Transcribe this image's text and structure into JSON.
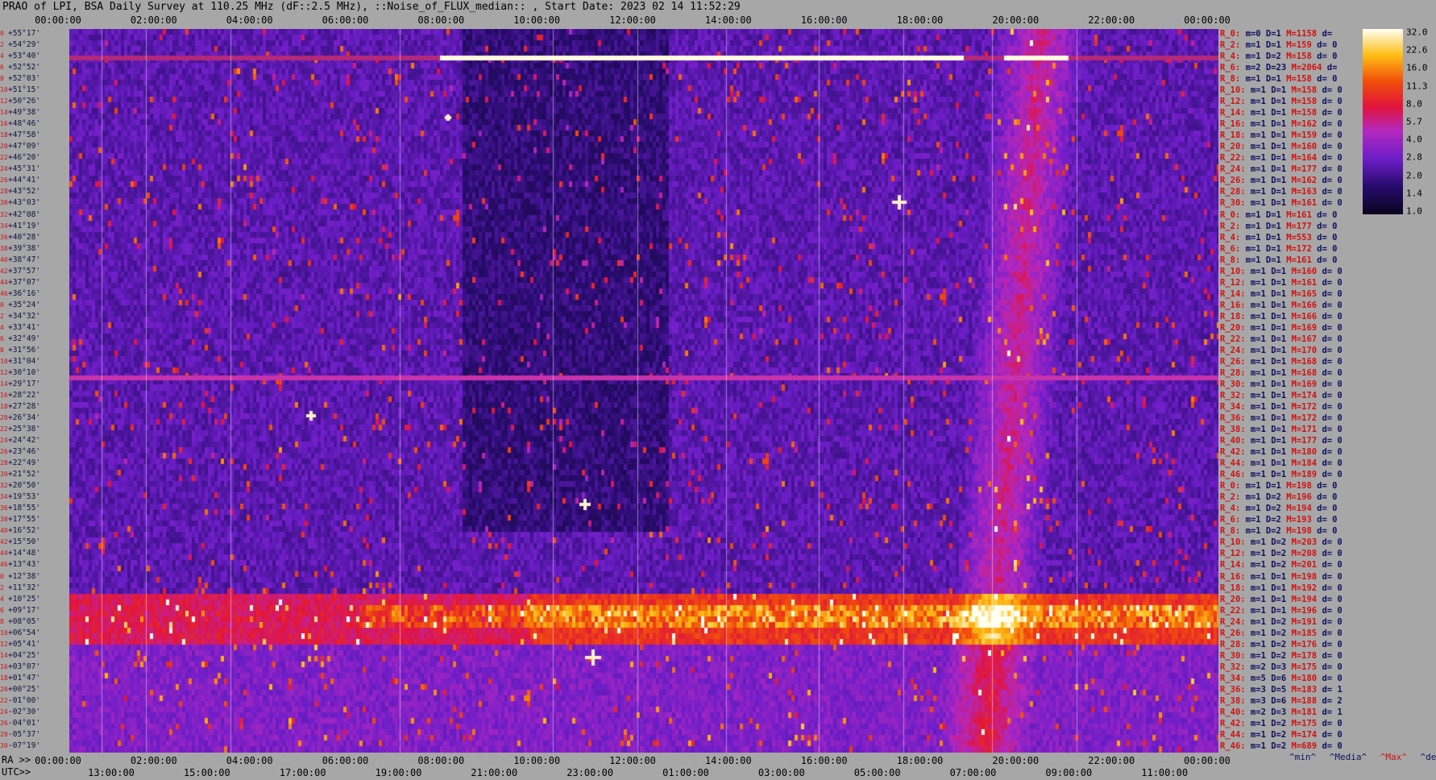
{
  "title": "PRAO of LPI, BSA Daily Survey at 110.25 MHz (dF::2.5 MHz), ::Noise_of_FLUX_median:: , Start Date: 2023 02 14 11:52:29",
  "top_axis": [
    "00:00:00",
    "02:00:00",
    "04:00:00",
    "06:00:00",
    "08:00:00",
    "10:00:00",
    "12:00:00",
    "14:00:00",
    "16:00:00",
    "18:00:00",
    "20:00:00",
    "22:00:00",
    "00:00:00"
  ],
  "ra_label": "RA >>",
  "ra_axis": [
    "00:00:00",
    "02:00:00",
    "04:00:00",
    "06:00:00",
    "08:00:00",
    "10:00:00",
    "12:00:00",
    "14:00:00",
    "16:00:00",
    "18:00:00",
    "20:00:00",
    "22:00:00",
    "00:00:00"
  ],
  "utc_label": "UTC>>",
  "utc_axis": [
    "13:00:00",
    "15:00:00",
    "17:00:00",
    "19:00:00",
    "21:00:00",
    "23:00:00",
    "01:00:00",
    "03:00:00",
    "05:00:00",
    "07:00:00",
    "09:00:00",
    "11:00:00"
  ],
  "footer": {
    "min": "^min^",
    "media": "^Media^",
    "max": "^Max^",
    "devia": "^devia^"
  },
  "colors": {
    "background": "#a7a7a7",
    "accent_red": "#d41010",
    "label_blue": "#101040"
  },
  "chart_data": {
    "type": "heatmap",
    "title": "PRAO of LPI, BSA Daily Survey at 110.25 MHz (dF::2.5 MHz), ::Noise_of_FLUX_median:: , Start Date: 2023 02 14 11:52:29",
    "x_axis_top": "RA 00:00:00 – 24:00:00",
    "y_axis": "Declination (beam rows)",
    "colorbar_ticks": [
      "32.0",
      "22.6",
      "16.0",
      "11.3",
      "8.0",
      "5.7",
      "4.0",
      "2.8",
      "2.0",
      "1.4",
      "1.0"
    ],
    "colorbar_scale": "log",
    "declinations": [
      {
        "idx": "0",
        "dec": "+55°17'"
      },
      {
        "idx": "2",
        "dec": "+54°29'"
      },
      {
        "idx": "4",
        "dec": "+53°40'"
      },
      {
        "idx": "6",
        "dec": "+52°52'"
      },
      {
        "idx": "8",
        "dec": "+52°03'"
      },
      {
        "idx": "10",
        "dec": "+51°15'"
      },
      {
        "idx": "12",
        "dec": "+50°26'"
      },
      {
        "idx": "14",
        "dec": "+49°38'"
      },
      {
        "idx": "16",
        "dec": "+48°46'"
      },
      {
        "idx": "18",
        "dec": "+47°58'"
      },
      {
        "idx": "20",
        "dec": "+47°09'"
      },
      {
        "idx": "22",
        "dec": "+46°20'"
      },
      {
        "idx": "24",
        "dec": "+45°31'"
      },
      {
        "idx": "26",
        "dec": "+44°41'"
      },
      {
        "idx": "28",
        "dec": "+43°52'"
      },
      {
        "idx": "30",
        "dec": "+43°03'"
      },
      {
        "idx": "32",
        "dec": "+42°08'"
      },
      {
        "idx": "34",
        "dec": "+41°19'"
      },
      {
        "idx": "36",
        "dec": "+40°28'"
      },
      {
        "idx": "38",
        "dec": "+39°38'"
      },
      {
        "idx": "40",
        "dec": "+38°47'"
      },
      {
        "idx": "42",
        "dec": "+37°57'"
      },
      {
        "idx": "44",
        "dec": "+37°07'"
      },
      {
        "idx": "46",
        "dec": "+36°16'"
      },
      {
        "idx": "0",
        "dec": "+35°24'"
      },
      {
        "idx": "2",
        "dec": "+34°32'"
      },
      {
        "idx": "4",
        "dec": "+33°41'"
      },
      {
        "idx": "6",
        "dec": "+32°49'"
      },
      {
        "idx": "8",
        "dec": "+31°56'"
      },
      {
        "idx": "10",
        "dec": "+31°04'"
      },
      {
        "idx": "12",
        "dec": "+30°10'"
      },
      {
        "idx": "14",
        "dec": "+29°17'"
      },
      {
        "idx": "16",
        "dec": "+28°22'"
      },
      {
        "idx": "18",
        "dec": "+27°28'"
      },
      {
        "idx": "20",
        "dec": "+26°34'"
      },
      {
        "idx": "22",
        "dec": "+25°38'"
      },
      {
        "idx": "24",
        "dec": "+24°42'"
      },
      {
        "idx": "26",
        "dec": "+23°46'"
      },
      {
        "idx": "28",
        "dec": "+22°49'"
      },
      {
        "idx": "30",
        "dec": "+21°52'"
      },
      {
        "idx": "32",
        "dec": "+20°50'"
      },
      {
        "idx": "34",
        "dec": "+19°53'"
      },
      {
        "idx": "36",
        "dec": "+18°55'"
      },
      {
        "idx": "38",
        "dec": "+17°55'"
      },
      {
        "idx": "40",
        "dec": "+16°52'"
      },
      {
        "idx": "42",
        "dec": "+15°50'"
      },
      {
        "idx": "44",
        "dec": "+14°48'"
      },
      {
        "idx": "46",
        "dec": "+13°43'"
      },
      {
        "idx": "0",
        "dec": "+12°38'"
      },
      {
        "idx": "2",
        "dec": "+11°32'"
      },
      {
        "idx": "4",
        "dec": "+10°25'"
      },
      {
        "idx": "6",
        "dec": "+09°17'"
      },
      {
        "idx": "8",
        "dec": "+08°05'"
      },
      {
        "idx": "10",
        "dec": "+06°54'"
      },
      {
        "idx": "12",
        "dec": "+05°41'"
      },
      {
        "idx": "14",
        "dec": "+04°25'"
      },
      {
        "idx": "16",
        "dec": "+03°07'"
      },
      {
        "idx": "18",
        "dec": "+01°47'"
      },
      {
        "idx": "20",
        "dec": "+00°25'"
      },
      {
        "idx": "22",
        "dec": "-01°00'"
      },
      {
        "idx": "24",
        "dec": "-02°30'"
      },
      {
        "idx": "26",
        "dec": "-04°01'"
      },
      {
        "idx": "28",
        "dec": "-05°37'"
      },
      {
        "idx": "30",
        "dec": "-07°19'"
      }
    ],
    "stats": [
      {
        "r": "R_0:",
        "m": "m=0",
        "d": "D=1",
        "mx": "M=1158",
        "dv": "d="
      },
      {
        "r": "R_2:",
        "m": "m=1",
        "d": "D=1",
        "mx": "M=159",
        "dv": "d= 0"
      },
      {
        "r": "R_4:",
        "m": "m=1",
        "d": "D=2",
        "mx": "M=158",
        "dv": "d= 0"
      },
      {
        "r": "R_6:",
        "m": "m=2",
        "d": "D=23",
        "mx": "M=2064",
        "dv": "d="
      },
      {
        "r": "R_8:",
        "m": "m=1",
        "d": "D=1",
        "mx": "M=158",
        "dv": "d= 0"
      },
      {
        "r": "R_10:",
        "m": "m=1",
        "d": "D=1",
        "mx": "M=158",
        "dv": "d= 0"
      },
      {
        "r": "R_12:",
        "m": "m=1",
        "d": "D=1",
        "mx": "M=158",
        "dv": "d= 0"
      },
      {
        "r": "R_14:",
        "m": "m=1",
        "d": "D=1",
        "mx": "M=158",
        "dv": "d= 0"
      },
      {
        "r": "R_16:",
        "m": "m=1",
        "d": "D=1",
        "mx": "M=162",
        "dv": "d= 0"
      },
      {
        "r": "R_18:",
        "m": "m=1",
        "d": "D=1",
        "mx": "M=159",
        "dv": "d= 0"
      },
      {
        "r": "R_20:",
        "m": "m=1",
        "d": "D=1",
        "mx": "M=160",
        "dv": "d= 0"
      },
      {
        "r": "R_22:",
        "m": "m=1",
        "d": "D=1",
        "mx": "M=164",
        "dv": "d= 0"
      },
      {
        "r": "R_24:",
        "m": "m=1",
        "d": "D=1",
        "mx": "M=177",
        "dv": "d= 0"
      },
      {
        "r": "R_26:",
        "m": "m=1",
        "d": "D=1",
        "mx": "M=162",
        "dv": "d= 0"
      },
      {
        "r": "R_28:",
        "m": "m=1",
        "d": "D=1",
        "mx": "M=163",
        "dv": "d= 0"
      },
      {
        "r": "R_30:",
        "m": "m=1",
        "d": "D=1",
        "mx": "M=161",
        "dv": "d= 0"
      },
      {
        "r": "R_0:",
        "m": "m=1",
        "d": "D=1",
        "mx": "M=161",
        "dv": "d= 0"
      },
      {
        "r": "R_2:",
        "m": "m=1",
        "d": "D=1",
        "mx": "M=177",
        "dv": "d= 0"
      },
      {
        "r": "R_4:",
        "m": "m=1",
        "d": "D=1",
        "mx": "M=553",
        "dv": "d= 0"
      },
      {
        "r": "R_6:",
        "m": "m=1",
        "d": "D=1",
        "mx": "M=172",
        "dv": "d= 0"
      },
      {
        "r": "R_8:",
        "m": "m=1",
        "d": "D=1",
        "mx": "M=161",
        "dv": "d= 0"
      },
      {
        "r": "R_10:",
        "m": "m=1",
        "d": "D=1",
        "mx": "M=160",
        "dv": "d= 0"
      },
      {
        "r": "R_12:",
        "m": "m=1",
        "d": "D=1",
        "mx": "M=161",
        "dv": "d= 0"
      },
      {
        "r": "R_14:",
        "m": "m=1",
        "d": "D=1",
        "mx": "M=165",
        "dv": "d= 0"
      },
      {
        "r": "R_16:",
        "m": "m=1",
        "d": "D=1",
        "mx": "M=166",
        "dv": "d= 0"
      },
      {
        "r": "R_18:",
        "m": "m=1",
        "d": "D=1",
        "mx": "M=166",
        "dv": "d= 0"
      },
      {
        "r": "R_20:",
        "m": "m=1",
        "d": "D=1",
        "mx": "M=169",
        "dv": "d= 0"
      },
      {
        "r": "R_22:",
        "m": "m=1",
        "d": "D=1",
        "mx": "M=167",
        "dv": "d= 0"
      },
      {
        "r": "R_24:",
        "m": "m=1",
        "d": "D=1",
        "mx": "M=170",
        "dv": "d= 0"
      },
      {
        "r": "R_26:",
        "m": "m=1",
        "d": "D=1",
        "mx": "M=168",
        "dv": "d= 0"
      },
      {
        "r": "R_28:",
        "m": "m=1",
        "d": "D=1",
        "mx": "M=168",
        "dv": "d= 0"
      },
      {
        "r": "R_30:",
        "m": "m=1",
        "d": "D=1",
        "mx": "M=169",
        "dv": "d= 0"
      },
      {
        "r": "R_32:",
        "m": "m=1",
        "d": "D=1",
        "mx": "M=174",
        "dv": "d= 0"
      },
      {
        "r": "R_34:",
        "m": "m=1",
        "d": "D=1",
        "mx": "M=172",
        "dv": "d= 0"
      },
      {
        "r": "R_36:",
        "m": "m=1",
        "d": "D=1",
        "mx": "M=172",
        "dv": "d= 0"
      },
      {
        "r": "R_38:",
        "m": "m=1",
        "d": "D=1",
        "mx": "M=171",
        "dv": "d= 0"
      },
      {
        "r": "R_40:",
        "m": "m=1",
        "d": "D=1",
        "mx": "M=177",
        "dv": "d= 0"
      },
      {
        "r": "R_42:",
        "m": "m=1",
        "d": "D=1",
        "mx": "M=180",
        "dv": "d= 0"
      },
      {
        "r": "R_44:",
        "m": "m=1",
        "d": "D=1",
        "mx": "M=184",
        "dv": "d= 0"
      },
      {
        "r": "R_46:",
        "m": "m=1",
        "d": "D=1",
        "mx": "M=189",
        "dv": "d= 0"
      },
      {
        "r": "R_0:",
        "m": "m=1",
        "d": "D=1",
        "mx": "M=198",
        "dv": "d= 0"
      },
      {
        "r": "R_2:",
        "m": "m=1",
        "d": "D=2",
        "mx": "M=196",
        "dv": "d= 0"
      },
      {
        "r": "R_4:",
        "m": "m=1",
        "d": "D=2",
        "mx": "M=194",
        "dv": "d= 0"
      },
      {
        "r": "R_6:",
        "m": "m=1",
        "d": "D=2",
        "mx": "M=193",
        "dv": "d= 0"
      },
      {
        "r": "R_8:",
        "m": "m=1",
        "d": "D=2",
        "mx": "M=198",
        "dv": "d= 0"
      },
      {
        "r": "R_10:",
        "m": "m=1",
        "d": "D=2",
        "mx": "M=203",
        "dv": "d= 0"
      },
      {
        "r": "R_12:",
        "m": "m=1",
        "d": "D=2",
        "mx": "M=208",
        "dv": "d= 0"
      },
      {
        "r": "R_14:",
        "m": "m=1",
        "d": "D=2",
        "mx": "M=201",
        "dv": "d= 0"
      },
      {
        "r": "R_16:",
        "m": "m=1",
        "d": "D=1",
        "mx": "M=198",
        "dv": "d= 0"
      },
      {
        "r": "R_18:",
        "m": "m=1",
        "d": "D=1",
        "mx": "M=192",
        "dv": "d= 0"
      },
      {
        "r": "R_20:",
        "m": "m=1",
        "d": "D=1",
        "mx": "M=194",
        "dv": "d= 0"
      },
      {
        "r": "R_22:",
        "m": "m=1",
        "d": "D=1",
        "mx": "M=196",
        "dv": "d= 0"
      },
      {
        "r": "R_24:",
        "m": "m=1",
        "d": "D=2",
        "mx": "M=191",
        "dv": "d= 0"
      },
      {
        "r": "R_26:",
        "m": "m=1",
        "d": "D=2",
        "mx": "M=185",
        "dv": "d= 0"
      },
      {
        "r": "R_28:",
        "m": "m=1",
        "d": "D=2",
        "mx": "M=176",
        "dv": "d= 0"
      },
      {
        "r": "R_30:",
        "m": "m=1",
        "d": "D=2",
        "mx": "M=178",
        "dv": "d= 0"
      },
      {
        "r": "R_32:",
        "m": "m=2",
        "d": "D=3",
        "mx": "M=175",
        "dv": "d= 0"
      },
      {
        "r": "R_34:",
        "m": "m=5",
        "d": "D=6",
        "mx": "M=180",
        "dv": "d= 0"
      },
      {
        "r": "R_36:",
        "m": "m=3",
        "d": "D=5",
        "mx": "M=183",
        "dv": "d= 1"
      },
      {
        "r": "R_38:",
        "m": "m=3",
        "d": "D=6",
        "mx": "M=188",
        "dv": "d= 2"
      },
      {
        "r": "R_40:",
        "m": "m=2",
        "d": "D=3",
        "mx": "M=181",
        "dv": "d= 1"
      },
      {
        "r": "R_42:",
        "m": "m=1",
        "d": "D=2",
        "mx": "M=175",
        "dv": "d= 0"
      },
      {
        "r": "R_44:",
        "m": "m=1",
        "d": "D=2",
        "mx": "M=174",
        "dv": "d= 0"
      },
      {
        "r": "R_46:",
        "m": "m=1",
        "d": "D=2",
        "mx": "M=689",
        "dv": "d= 0"
      }
    ]
  }
}
